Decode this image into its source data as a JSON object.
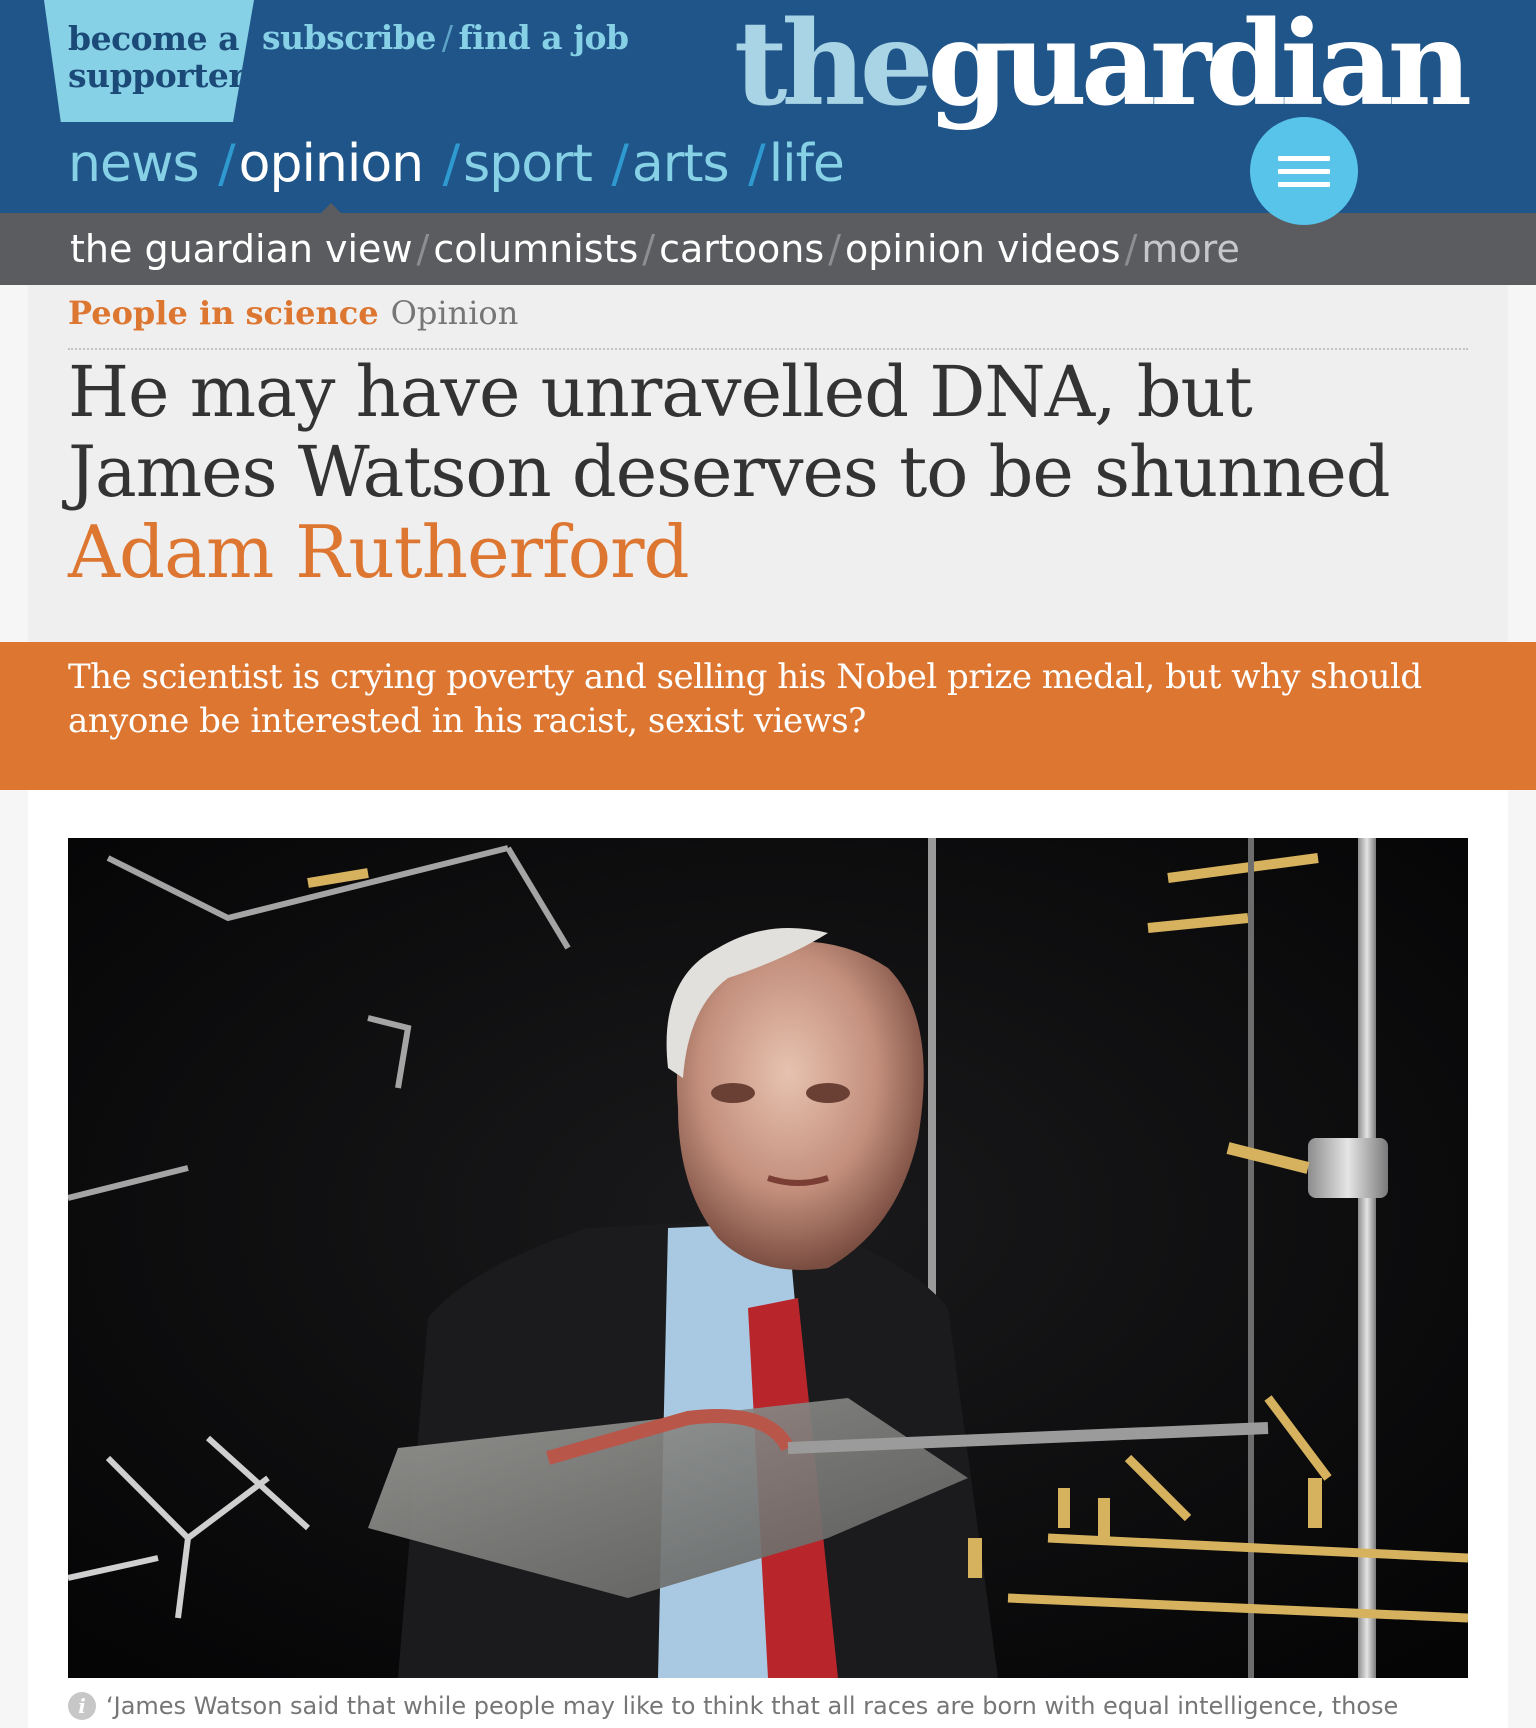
{
  "header": {
    "supporter_line1": "become a",
    "supporter_line2": "supporter",
    "subscribe": "subscribe",
    "find_job": "find a job",
    "link_separator": "/",
    "logo_the": "the",
    "logo_guardian": "guardian",
    "pillars": [
      {
        "label": "news"
      },
      {
        "label": "opinion",
        "active": true
      },
      {
        "label": "sport"
      },
      {
        "label": "arts"
      },
      {
        "label": "life"
      }
    ],
    "pillar_separator": "/",
    "menu_icon": "hamburger-icon"
  },
  "subnav": {
    "items": [
      "the guardian view",
      "columnists",
      "cartoons",
      "opinion videos",
      "more"
    ],
    "separator": "/"
  },
  "article": {
    "series": "People in science",
    "tone": "Opinion",
    "headline": "He may have unravelled DNA, but James Watson deserves to be shunned",
    "byline": "Adam Rutherford",
    "standfirst": "The scientist is crying poverty and selling his Nobel prize medal, but why should anyone be interested in his racist, sexist views?",
    "caption_icon": "info-icon",
    "caption_icon_glyph": "i",
    "caption": "‘James Watson said that while people may like to think that all races are born with equal intelligence, those"
  },
  "colors": {
    "brand_blue": "#1f5589",
    "light_blue": "#87d1e6",
    "menu_blue": "#58c4ea",
    "opinion_orange": "#dd7630",
    "subnav_gray": "#5a5c60"
  }
}
